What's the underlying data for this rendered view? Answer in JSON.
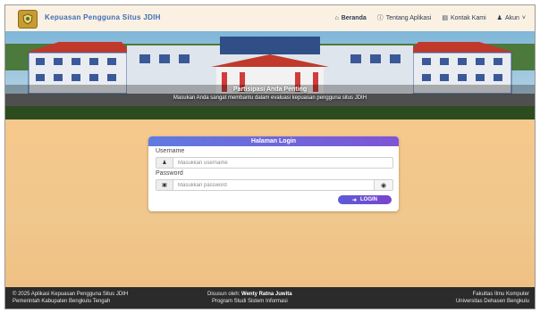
{
  "navbar": {
    "brand": "Kepuasan Pengguna Situs JDIH",
    "links": [
      {
        "label": "Beranda",
        "icon": "home-icon"
      },
      {
        "label": "Tentang Aplikasi",
        "icon": "info-icon"
      },
      {
        "label": "Kontak Kami",
        "icon": "contact-card-icon"
      },
      {
        "label": "Akun",
        "icon": "user-icon"
      }
    ]
  },
  "hero": {
    "title": "Partisipasi Anda Penting",
    "subtitle": "Masukan Anda sangat membantu dalam evaluasi kepuasan pengguna situs JDIH"
  },
  "login": {
    "header": "Halaman Login",
    "username_label": "Username",
    "username_placeholder": "Masukkan username",
    "password_label": "Password",
    "password_placeholder": "Masukkan password",
    "button": "LOGIN"
  },
  "footer": {
    "left_line1": "© 2025 Aplikasi Kepuasan Pengguna Situs JDIH",
    "left_line2": "Pemerintah Kabupaten Bengkulu Tengah",
    "mid_prefix": "Disusun oleh:",
    "mid_name": "Wenty Ratna Juwita",
    "mid_line2": "Program Studi Sistem Informasi",
    "right_line1": "Fakultas Ilmu Komputer",
    "right_line2": "Universitas Dehasen Bengkulu"
  },
  "colors": {
    "navbar_bg": "#fbf1e2",
    "brand": "#3e6db6",
    "page_bg": "#f2c68b",
    "card_header": "#6a67dd",
    "footer_bg": "#2b2b2b"
  }
}
